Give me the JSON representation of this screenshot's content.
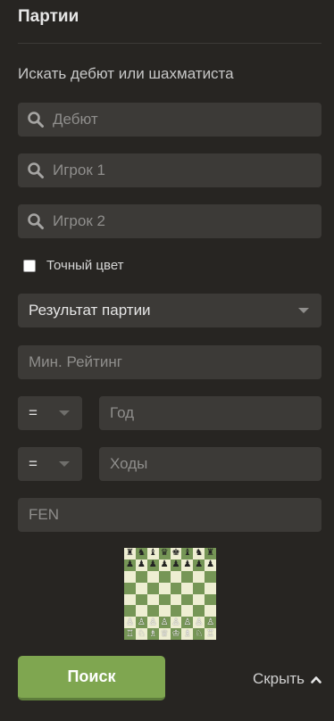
{
  "panel": {
    "title": "Партии",
    "subtitle": "Искать дебют или шахматиста"
  },
  "search": {
    "opening_placeholder": "Дебют",
    "player1_placeholder": "Игрок 1",
    "player2_placeholder": "Игрок 2",
    "exact_color_label": "Точный цвет",
    "exact_color_checked": false,
    "result_select": "Результат партии",
    "min_rating_placeholder": "Мин. Рейтинг",
    "year_operator": "=",
    "year_placeholder": "Год",
    "moves_operator": "=",
    "moves_placeholder": "Ходы",
    "fen_placeholder": "FEN",
    "search_button": "Поиск",
    "hide_link": "Скрыть"
  },
  "board": {
    "ranks": [
      [
        "♜",
        "♞",
        "♝",
        "♛",
        "♚",
        "♝",
        "♞",
        "♜"
      ],
      [
        "♟",
        "♟",
        "♟",
        "♟",
        "♟",
        "♟",
        "♟",
        "♟"
      ],
      [
        "",
        "",
        "",
        "",
        "",
        "",
        "",
        ""
      ],
      [
        "",
        "",
        "",
        "",
        "",
        "",
        "",
        ""
      ],
      [
        "",
        "",
        "",
        "",
        "",
        "",
        "",
        ""
      ],
      [
        "",
        "",
        "",
        "",
        "",
        "",
        "",
        ""
      ],
      [
        "♙",
        "♙",
        "♙",
        "♙",
        "♙",
        "♙",
        "♙",
        "♙"
      ],
      [
        "♖",
        "♘",
        "♗",
        "♕",
        "♔",
        "♗",
        "♘",
        "♖"
      ]
    ]
  },
  "icons": {
    "search": "search-icon",
    "caret": "caret-down-icon",
    "chevron": "chevron-up-icon"
  },
  "colors": {
    "background": "#272522",
    "field": "#3c3a37",
    "primary": "#7fa650",
    "board_light": "#eeeed2",
    "board_dark": "#769656"
  }
}
